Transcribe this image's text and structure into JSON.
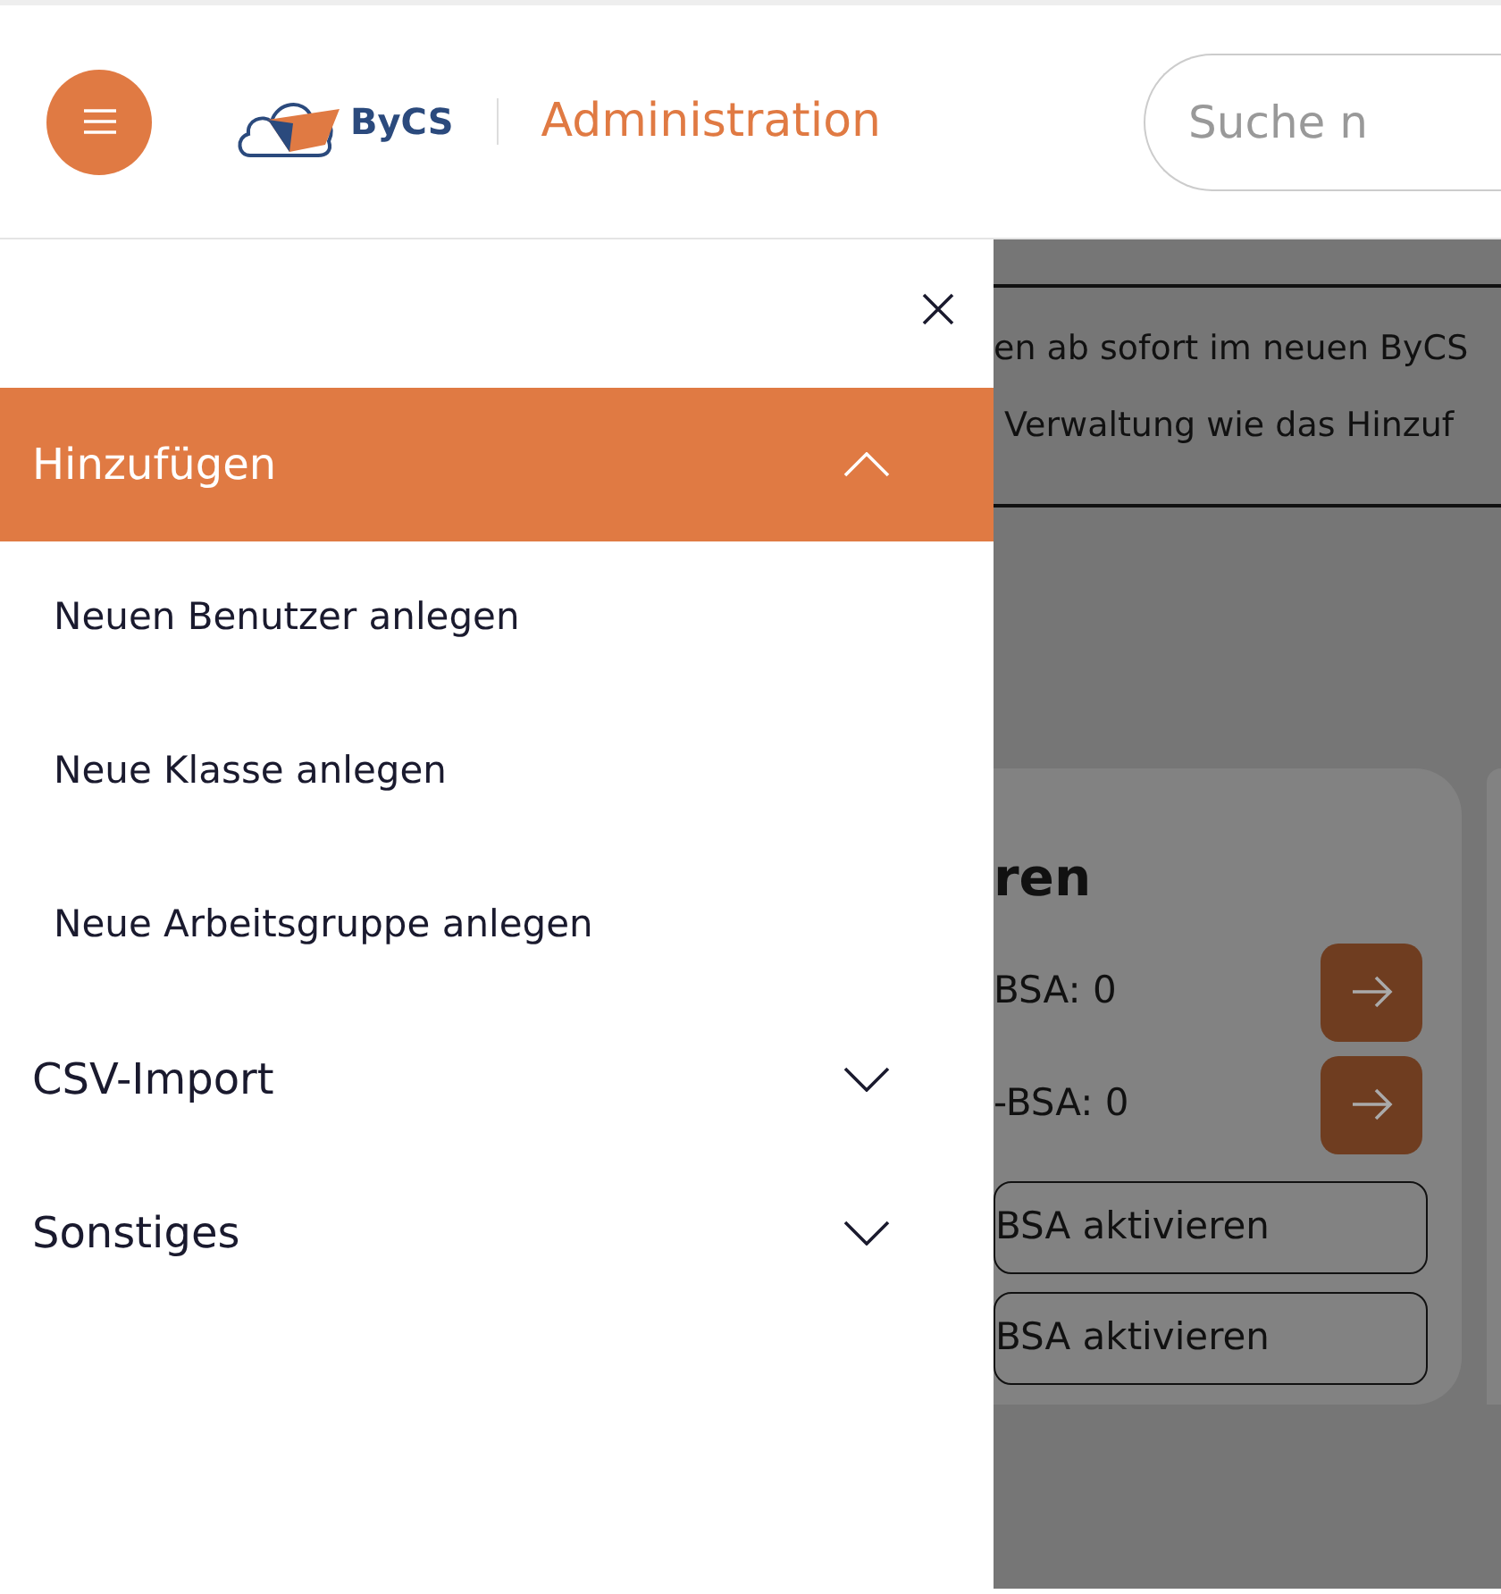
{
  "header": {
    "logo_text": "ByCS",
    "title": "Administration",
    "search": {
      "placeholder": "Suche n"
    }
  },
  "drawer": {
    "sections": [
      {
        "label": "Hinzufügen",
        "expanded": true,
        "items": [
          "Neuen Benutzer anlegen",
          "Neue Klasse anlegen",
          "Neue Arbeitsgruppe anlegen"
        ]
      },
      {
        "label": "CSV-Import",
        "expanded": false
      },
      {
        "label": "Sonstiges",
        "expanded": false
      }
    ]
  },
  "background": {
    "notice_lines": [
      "en ab sofort im neuen ByCS",
      "Verwaltung wie das Hinzuf"
    ],
    "card": {
      "title": "ren",
      "rows": [
        "BSA: 0",
        "-BSA: 0"
      ],
      "buttons": [
        "BSA aktivieren",
        "BSA aktivieren"
      ]
    }
  }
}
